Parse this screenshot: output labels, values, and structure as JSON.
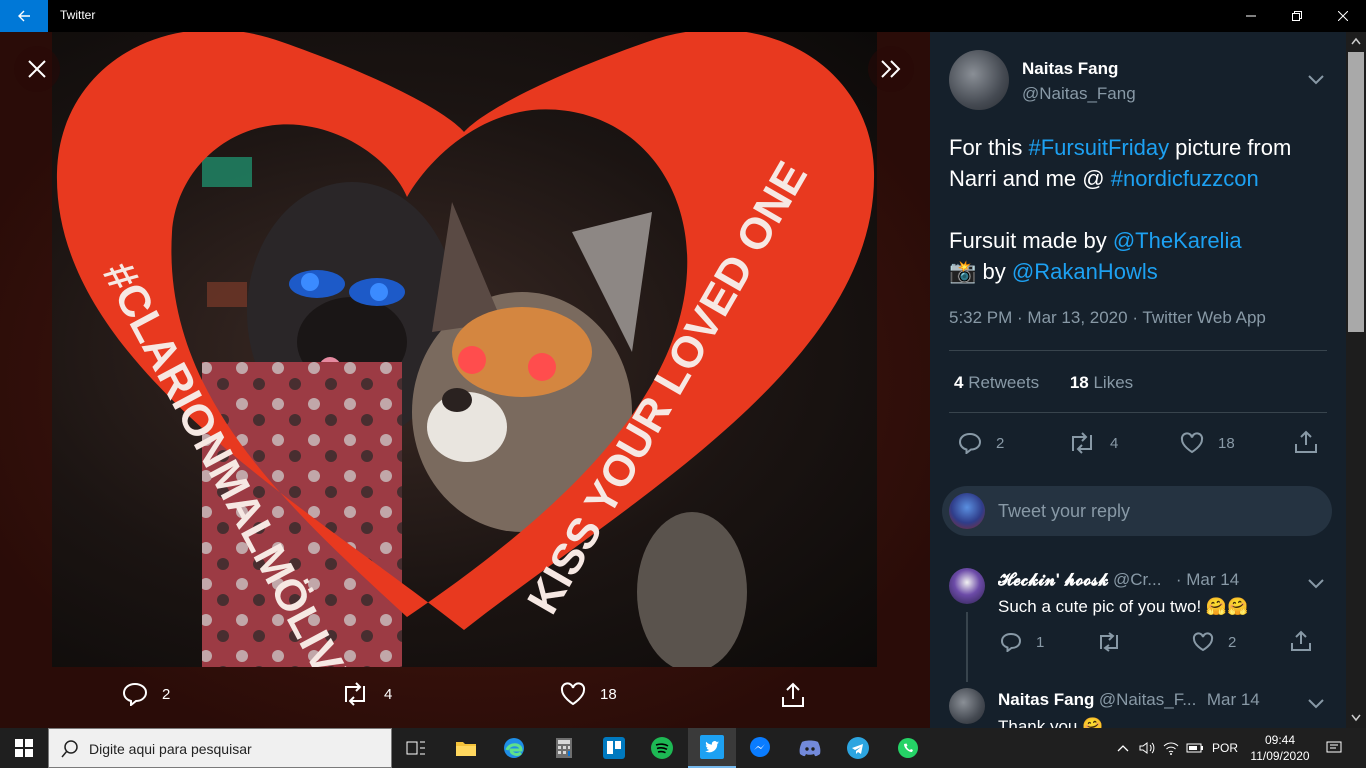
{
  "window": {
    "title": "Twitter"
  },
  "media": {
    "sign_left": "#CLARIONMALMÖLIVE",
    "sign_right": "KISS YOUR LOVED ONE",
    "actions": {
      "replies": "2",
      "retweets": "4",
      "likes": "18"
    }
  },
  "tweet": {
    "name": "Naitas Fang",
    "handle": "@Naitas_Fang",
    "line1_a": "For this ",
    "line1_tag": "#FursuitFriday",
    "line1_b": " picture from",
    "line2_a": "Narri and me @ ",
    "line2_tag": "#nordicfuzzcon",
    "line3_a": "Fursuit made by ",
    "line3_mention": "@TheKarelia",
    "line4_emoji": "📸",
    "line4_a": " by ",
    "line4_mention": "@RakanHowls",
    "meta": "5:32 PM · Mar 13, 2020 · Twitter Web App",
    "retweets_count": "4",
    "retweets_label": "Retweets",
    "likes_count": "18",
    "likes_label": "Likes",
    "actions": {
      "replies": "2",
      "retweets": "4",
      "likes": "18"
    }
  },
  "reply_box": {
    "placeholder": "Tweet your reply"
  },
  "replies": [
    {
      "name": "𝓗𝓮𝓬𝓴𝓲𝓷' 𝓱𝓸𝓸𝓼𝓴",
      "handle": "@Cr...",
      "date": "· Mar 14",
      "text": "Such a cute pic of you two! 🤗🤗",
      "replies": "1",
      "likes": "2"
    },
    {
      "name": "Naitas Fang",
      "handle": "@Naitas_F...",
      "date": "Mar 14",
      "text": "Thank you 🤗"
    }
  ],
  "taskbar": {
    "search_placeholder": "Digite aqui para pesquisar",
    "language": "POR",
    "time": "09:44",
    "date": "11/09/2020"
  },
  "colors": {
    "accent": "#1da1f2",
    "panel_bg": "#15202b",
    "heart_red": "#e8391f",
    "windows_blue": "#0078d7"
  }
}
